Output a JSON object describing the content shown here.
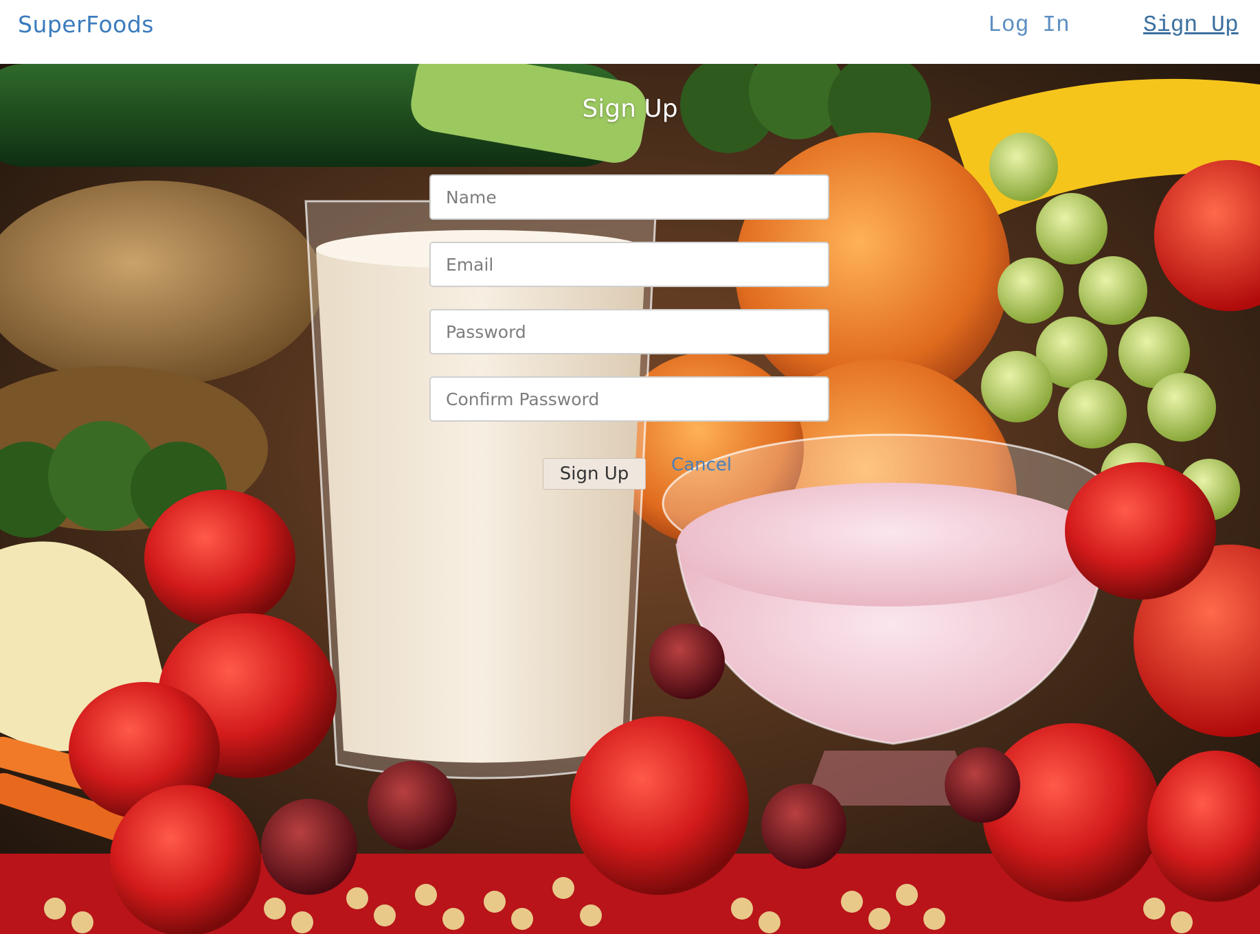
{
  "header": {
    "brand": "SuperFoods",
    "nav": {
      "login_label": "Log In",
      "signup_label": "Sign Up"
    }
  },
  "form": {
    "title": "Sign Up",
    "fields": {
      "name_placeholder": "Name",
      "email_placeholder": "Email",
      "password_placeholder": "Password",
      "confirm_placeholder": "Confirm Password"
    },
    "submit_label": "Sign Up",
    "cancel_label": "Cancel"
  },
  "colors": {
    "brand": "#3b7bbd",
    "nav_link": "#5c8fc2",
    "cancel_link": "#4a7fb8"
  }
}
